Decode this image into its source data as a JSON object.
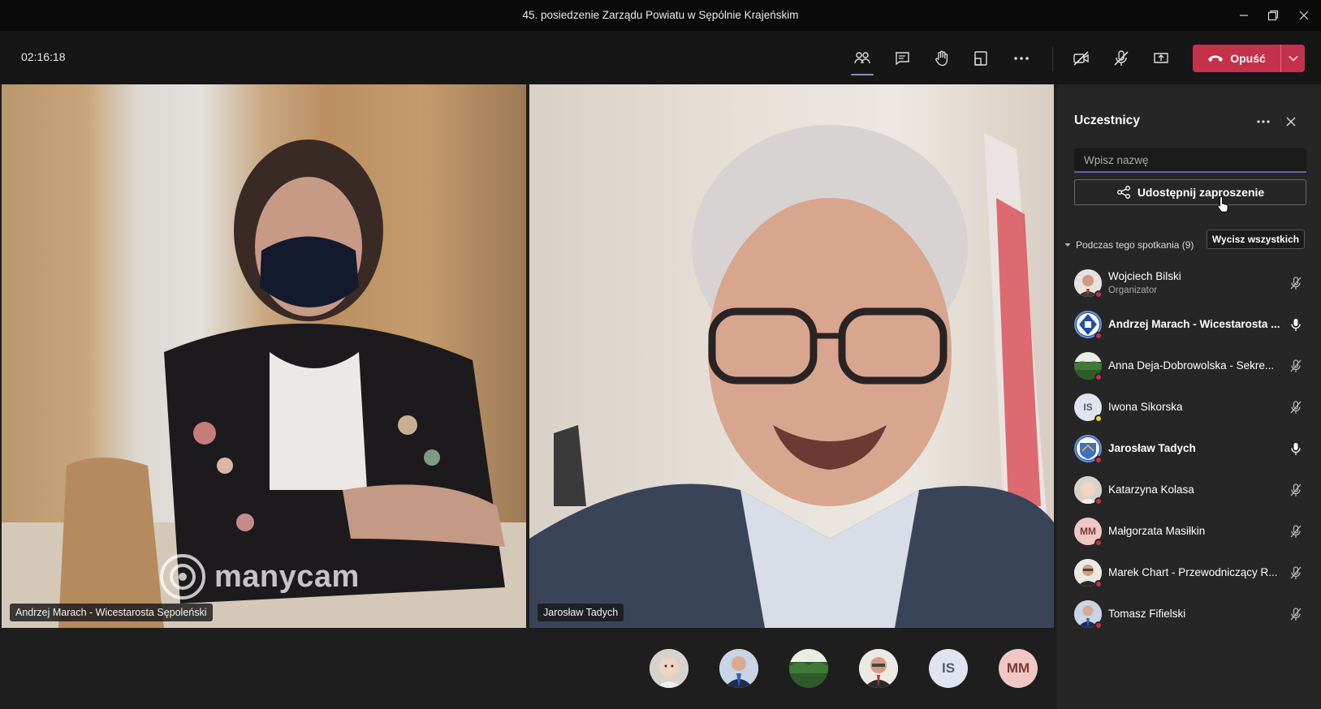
{
  "window": {
    "title": "45. posiedzenie Zarządu Powiatu w Sępólnie Krajeńskim"
  },
  "toolbar": {
    "timer": "02:16:18",
    "leave_label": "Opuść"
  },
  "colors": {
    "accent": "#6264a7",
    "leave": "#c4314b",
    "status_busy": "#c4314b",
    "status_away": "#f8d22a"
  },
  "stage": {
    "tile_a_name": "Andrzej Marach - Wicestarosta Sępoleński",
    "tile_b_name": "Jarosław Tadych",
    "watermark": "manycam",
    "strip": [
      {
        "initials": "",
        "icon": "photo-baby"
      },
      {
        "initials": "",
        "icon": "photo-man-suit"
      },
      {
        "initials": "",
        "icon": "photo-forest"
      },
      {
        "initials": "",
        "icon": "photo-man"
      },
      {
        "initials": "IS",
        "icon": "initials"
      },
      {
        "initials": "MM",
        "icon": "initials"
      }
    ]
  },
  "panel": {
    "title": "Uczestnicy",
    "search_placeholder": "Wpisz nazwę",
    "share_label": "Udostępnij zaproszenie",
    "section_label": "Podczas tego spotkania (9)",
    "mute_all_label": "Wycisz wszystkich",
    "participants": [
      {
        "name": "Wojciech Bilski",
        "role": "Organizator",
        "initials": "",
        "mic": "muted",
        "status": "busy",
        "bold": false
      },
      {
        "name": "Andrzej Marach - Wicestarosta ...",
        "role": "",
        "initials": "",
        "mic": "on",
        "status": "busy",
        "bold": true
      },
      {
        "name": "Anna Deja-Dobrowolska - Sekre...",
        "role": "",
        "initials": "",
        "mic": "muted",
        "status": "busy",
        "bold": false
      },
      {
        "name": "Iwona Sikorska",
        "role": "",
        "initials": "IS",
        "mic": "muted",
        "status": "away",
        "bold": false
      },
      {
        "name": "Jarosław Tadych",
        "role": "",
        "initials": "",
        "mic": "on",
        "status": "busy",
        "bold": true
      },
      {
        "name": "Katarzyna Kolasa",
        "role": "",
        "initials": "",
        "mic": "muted",
        "status": "busy",
        "bold": false
      },
      {
        "name": "Małgorzata Masiłkin",
        "role": "",
        "initials": "MM",
        "mic": "muted",
        "status": "busy",
        "bold": false
      },
      {
        "name": "Marek Chart - Przewodniczący R...",
        "role": "",
        "initials": "",
        "mic": "muted",
        "status": "busy",
        "bold": false
      },
      {
        "name": "Tomasz Fifielski",
        "role": "",
        "initials": "",
        "mic": "muted",
        "status": "busy",
        "bold": false
      }
    ]
  }
}
